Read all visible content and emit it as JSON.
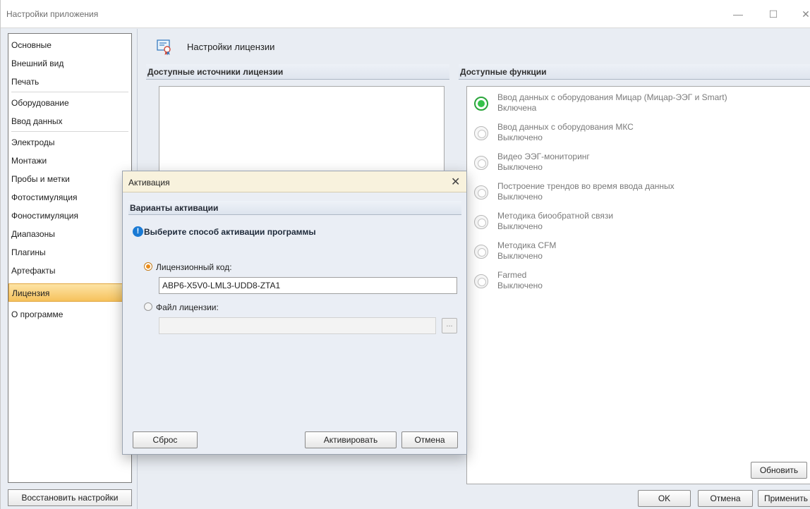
{
  "window": {
    "title": "Настройки приложения",
    "controls": {
      "minimize": "—",
      "maximize": "☐",
      "close": "✕"
    }
  },
  "sidebar": {
    "items": [
      {
        "label": "Основные"
      },
      {
        "label": "Внешний вид"
      },
      {
        "label": "Печать"
      },
      {
        "label": "Оборудование"
      },
      {
        "label": "Ввод данных"
      },
      {
        "label": "Электроды"
      },
      {
        "label": "Монтажи"
      },
      {
        "label": "Пробы и метки"
      },
      {
        "label": "Фотостимуляция"
      },
      {
        "label": "Фоностимуляция"
      },
      {
        "label": "Диапазоны"
      },
      {
        "label": "Плагины"
      },
      {
        "label": "Артефакты"
      },
      {
        "label": "Лицензия",
        "active": true
      },
      {
        "label": "О программе"
      }
    ],
    "restore_button": "Восстановить настройки"
  },
  "page": {
    "title": "Настройки лицензии",
    "icon": "certificate-icon",
    "sources_title": "Доступные источники лицензии",
    "features_title": "Доступные функции",
    "features": [
      {
        "name": "Ввод данных с оборудования Мицар (Мицар-ЭЭГ и Smart)",
        "state": "Включена",
        "enabled": true
      },
      {
        "name": "Ввод данных с оборудования МКС",
        "state": "Выключено",
        "enabled": false
      },
      {
        "name": "Видео ЭЭГ-мониторинг",
        "state": "Выключено",
        "enabled": false
      },
      {
        "name": "Построение трендов во время ввода данных",
        "state": "Выключено",
        "enabled": false
      },
      {
        "name": "Методика биообратной связи",
        "state": "Выключено",
        "enabled": false
      },
      {
        "name": "Методика CFM",
        "state": "Выключено",
        "enabled": false
      },
      {
        "name": "Farmed",
        "state": "Выключено",
        "enabled": false
      }
    ],
    "buttons": {
      "refresh": "Обновить",
      "ok": "OK",
      "cancel": "Отмена",
      "apply": "Применить"
    }
  },
  "dialog": {
    "title": "Активация",
    "section": "Варианты активации",
    "hint": "Выберите способ активации программы",
    "option_code_label": "Лицензионный код:",
    "option_code_value": "ABP6-X5V0-LML3-UDD8-ZTA1",
    "option_file_label": "Файл лицензии:",
    "option_file_value": "",
    "browse": "...",
    "selected_option": "code",
    "buttons": {
      "reset": "Сброс",
      "activate": "Активировать",
      "cancel": "Отмена"
    }
  },
  "colors": {
    "active_nav": "#f6c25c",
    "enabled_radio": "#35c24a",
    "selected_option_radio": "#ec8c18",
    "dialog_title_bg": "#f8f2dd"
  }
}
